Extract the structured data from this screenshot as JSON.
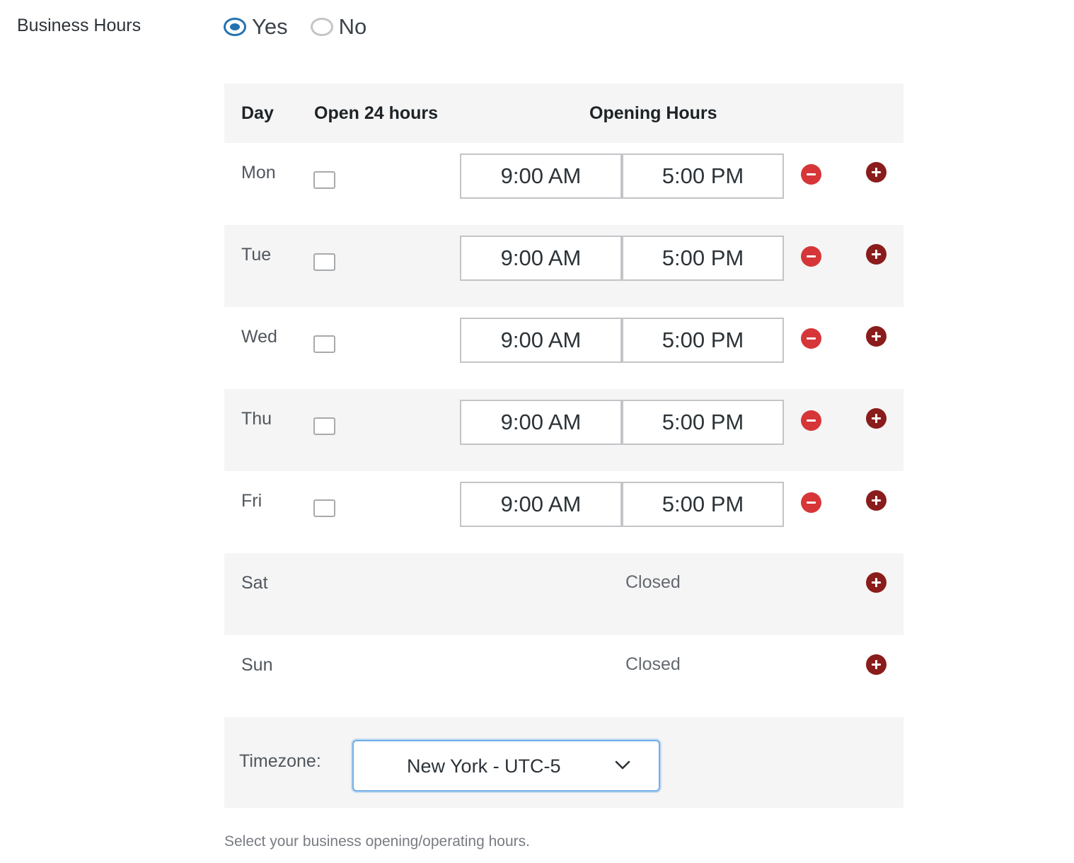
{
  "field": {
    "label": "Business Hours"
  },
  "toggle": {
    "yes_label": "Yes",
    "no_label": "No",
    "selected": "Yes"
  },
  "table": {
    "headers": {
      "day": "Day",
      "open24": "Open 24 hours",
      "hours": "Opening Hours"
    },
    "rows": [
      {
        "day": "Mon",
        "open": "9:00 AM",
        "close": "5:00 PM",
        "closed": false
      },
      {
        "day": "Tue",
        "open": "9:00 AM",
        "close": "5:00 PM",
        "closed": false
      },
      {
        "day": "Wed",
        "open": "9:00 AM",
        "close": "5:00 PM",
        "closed": false
      },
      {
        "day": "Thu",
        "open": "9:00 AM",
        "close": "5:00 PM",
        "closed": false
      },
      {
        "day": "Fri",
        "open": "9:00 AM",
        "close": "5:00 PM",
        "closed": false
      },
      {
        "day": "Sat",
        "closed": true,
        "closed_label": "Closed"
      },
      {
        "day": "Sun",
        "closed": true,
        "closed_label": "Closed"
      }
    ]
  },
  "timezone": {
    "label": "Timezone:",
    "value": "New York - UTC-5"
  },
  "help_text": "Select your business opening/operating hours.",
  "icons": {
    "remove": "minus-circle-icon",
    "add": "plus-circle-icon",
    "dropdown": "chevron-down-icon"
  },
  "colors": {
    "accent": "#2271b1",
    "remove_button": "#d63638",
    "add_button": "#8a1c1c",
    "row_alt": "#f5f5f5"
  }
}
